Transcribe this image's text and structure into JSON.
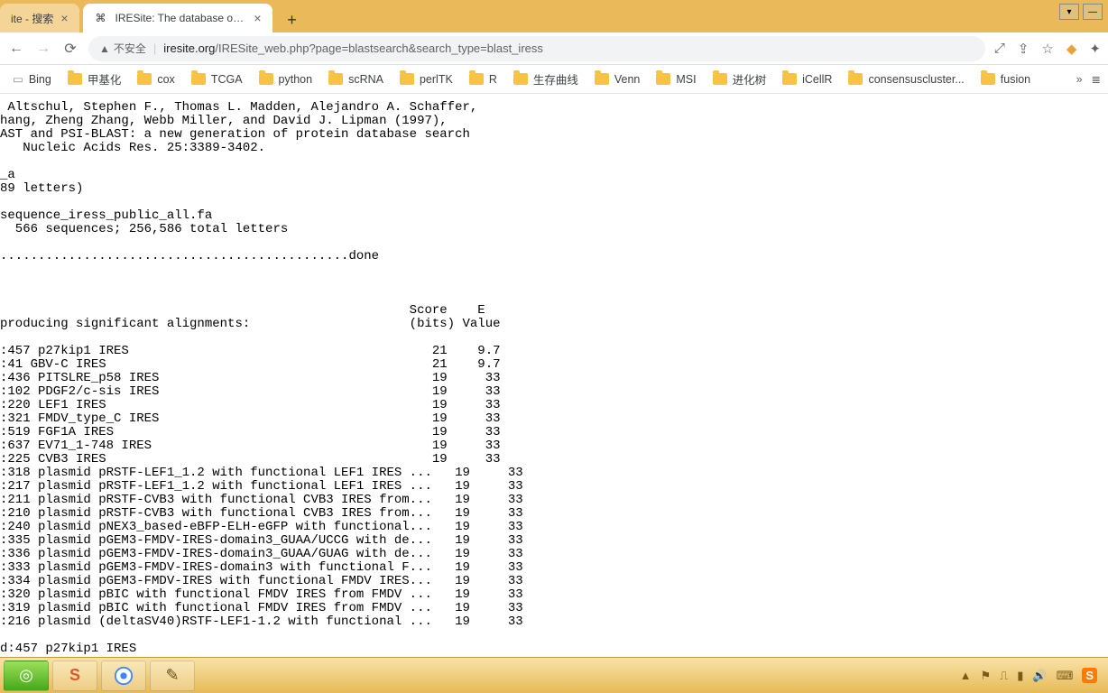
{
  "tabs": {
    "inactive": {
      "title": "ite - 搜索"
    },
    "active": {
      "favicon": "⌘",
      "title": "IRESite: The database of exper"
    },
    "newtab": "+"
  },
  "window_controls": {
    "min": "—",
    "down": "▾"
  },
  "nav": {
    "back": "←",
    "forward": "→",
    "reload": "⟳"
  },
  "url": {
    "warn_icon": "▲",
    "warn_text": "不安全",
    "host": "iresite.org",
    "path": "/IRESite_web.php?page=blastsearch&search_type=blast_iress"
  },
  "addr_icons": {
    "translate": "⤢",
    "share": "⇪",
    "star": "☆",
    "yellow": "◆",
    "ext": "✦"
  },
  "bookmarks": [
    {
      "type": "page",
      "label": "Bing"
    },
    {
      "type": "folder",
      "label": "甲基化"
    },
    {
      "type": "folder",
      "label": "cox"
    },
    {
      "type": "folder",
      "label": "TCGA"
    },
    {
      "type": "folder",
      "label": "python"
    },
    {
      "type": "folder",
      "label": "scRNA"
    },
    {
      "type": "folder",
      "label": "perlTK"
    },
    {
      "type": "folder",
      "label": "R"
    },
    {
      "type": "folder",
      "label": "生存曲线"
    },
    {
      "type": "folder",
      "label": "Venn"
    },
    {
      "type": "folder",
      "label": "MSI"
    },
    {
      "type": "folder",
      "label": "进化树"
    },
    {
      "type": "folder",
      "label": "iCellR"
    },
    {
      "type": "folder",
      "label": "consensuscluster..."
    },
    {
      "type": "folder",
      "label": "fusion"
    }
  ],
  "bm_overflow": {
    "chev": "»",
    "list": "≣"
  },
  "blast": {
    "ref": " Altschul, Stephen F., Thomas L. Madden, Alejandro A. Schaffer,\nhang, Zheng Zhang, Webb Miller, and David J. Lipman (1997),\nAST and PSI-BLAST: a new generation of protein database search\n   Nucleic Acids Res. 25:3389-3402.",
    "query": "_a\n89 letters)",
    "db": "sequence_iress_public_all.fa\n  566 sequences; 256,586 total letters",
    "progress": "..............................................done",
    "header": "                                                      Score    E\nproducing significant alignments:                     (bits) Value",
    "rows": [
      {
        "id": "457",
        "desc": "p27kip1 IRES",
        "score": "21",
        "e": "9.7"
      },
      {
        "id": "41",
        "desc": "GBV-C IRES",
        "score": "21",
        "e": "9.7"
      },
      {
        "id": "436",
        "desc": "PITSLRE_p58 IRES",
        "score": "19",
        "e": "33"
      },
      {
        "id": "102",
        "desc": "PDGF2/c-sis IRES",
        "score": "19",
        "e": "33"
      },
      {
        "id": "220",
        "desc": "LEF1 IRES",
        "score": "19",
        "e": "33"
      },
      {
        "id": "321",
        "desc": "FMDV_type_C IRES",
        "score": "19",
        "e": "33"
      },
      {
        "id": "519",
        "desc": "FGF1A IRES",
        "score": "19",
        "e": "33"
      },
      {
        "id": "637",
        "desc": "EV71_1-748 IRES",
        "score": "19",
        "e": "33"
      },
      {
        "id": "225",
        "desc": "CVB3 IRES",
        "score": "19",
        "e": "33"
      },
      {
        "id": "318",
        "desc": "plasmid pRSTF-LEF1_1.2 with functional LEF1 IRES ...",
        "score": "19",
        "e": "33"
      },
      {
        "id": "217",
        "desc": "plasmid pRSTF-LEF1_1.2 with functional LEF1 IRES ...",
        "score": "19",
        "e": "33"
      },
      {
        "id": "211",
        "desc": "plasmid pRSTF-CVB3 with functional CVB3 IRES from...",
        "score": "19",
        "e": "33"
      },
      {
        "id": "210",
        "desc": "plasmid pRSTF-CVB3 with functional CVB3 IRES from...",
        "score": "19",
        "e": "33"
      },
      {
        "id": "240",
        "desc": "plasmid pNEX3_based-eBFP-ELH-eGFP with functional...",
        "score": "19",
        "e": "33"
      },
      {
        "id": "335",
        "desc": "plasmid pGEM3-FMDV-IRES-domain3_GUAA/UCCG with de...",
        "score": "19",
        "e": "33"
      },
      {
        "id": "336",
        "desc": "plasmid pGEM3-FMDV-IRES-domain3_GUAA/GUAG with de...",
        "score": "19",
        "e": "33"
      },
      {
        "id": "333",
        "desc": "plasmid pGEM3-FMDV-IRES-domain3 with functional F...",
        "score": "19",
        "e": "33"
      },
      {
        "id": "334",
        "desc": "plasmid pGEM3-FMDV-IRES with functional FMDV IRES...",
        "score": "19",
        "e": "33"
      },
      {
        "id": "320",
        "desc": "plasmid pBIC with functional FMDV IRES from FMDV ...",
        "score": "19",
        "e": "33"
      },
      {
        "id": "319",
        "desc": "plasmid pBIC with functional FMDV IRES from FMDV ...",
        "score": "19",
        "e": "33"
      },
      {
        "id": "216",
        "desc": "plasmid (deltaSV40)RSTF-LEF1-1.2 with functional ...",
        "score": "19",
        "e": "33"
      }
    ],
    "footer": "d:457 p27kip1 IRES"
  },
  "task": {
    "start": "◎",
    "snag": "S",
    "chrome": "●",
    "notes": "✎"
  },
  "tray": {
    "arrow": "▲",
    "flag": "⚑",
    "dev": "⎍",
    "net": "▮",
    "vol": "🔊",
    "ime": "⌨",
    "sogou": "S"
  }
}
